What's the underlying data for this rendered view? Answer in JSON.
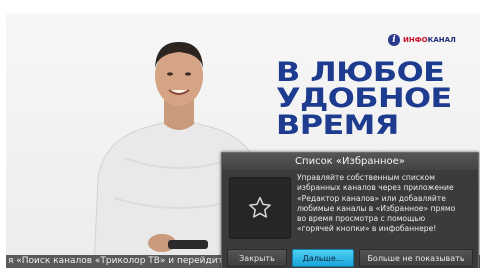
{
  "promo": {
    "logo_prefix": "ИНФО",
    "logo_suffix": "КАНАЛ",
    "headline_line1": "В ЛЮБОЕ",
    "headline_line2": "УДОБНОЕ",
    "headline_line3": "ВРЕМЯ"
  },
  "ticker": {
    "text": "я «Поиск каналов «Триколор ТВ» и перейдите к настройкам в разделе «Установки»..."
  },
  "dialog": {
    "title": "Список «Избранное»",
    "icon": "star-icon",
    "message_lines": [
      "Управляйте собственным списком",
      "избранных каналов через приложение",
      "«Редактор каналов» или добавляйте",
      "любимые каналы в «Избранное» прямо",
      "во время просмотра с помощью",
      "«горячей кнопки» в инфобаннере!"
    ],
    "buttons": {
      "close": "Закрыть",
      "next": "Дальше...",
      "dont_show": "Больше не показывать"
    }
  },
  "colors": {
    "headline": "#1d3b8f",
    "accent_button": "#1aa4d9",
    "dialog_bg": "#3b3b3b"
  }
}
